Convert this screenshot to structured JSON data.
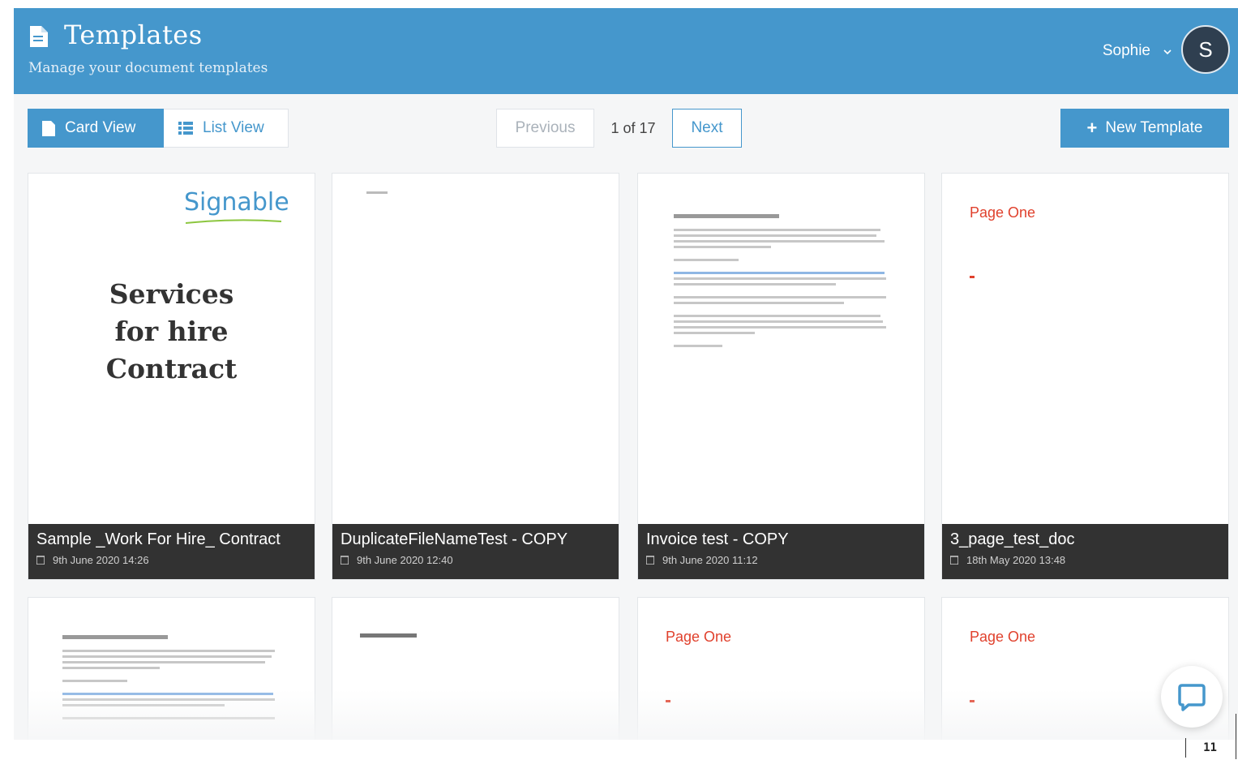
{
  "header": {
    "title": "Templates",
    "subtitle": "Manage your document templates",
    "user_name": "Sophie",
    "avatar_initial": "S",
    "bg_color": "#4597cc"
  },
  "toolbar": {
    "card_view_label": "Card View",
    "list_view_label": "List View",
    "active_view": "Card View",
    "previous_label": "Previous",
    "page_count": "1 of 17",
    "next_label": "Next",
    "new_template_label": "New Template"
  },
  "templates": [
    {
      "name": "Sample _Work For Hire_ Contract",
      "date": "9th June 2020 14:26",
      "preview": "contract"
    },
    {
      "name": "DuplicateFileNameTest - COPY",
      "date": "9th June 2020 12:40",
      "preview": "blank"
    },
    {
      "name": "Invoice test - COPY",
      "date": "9th June 2020 11:12",
      "preview": "letter"
    },
    {
      "name": "3_page_test_doc",
      "date": "18th May 2020 13:48",
      "preview": "page-one"
    }
  ],
  "previews": {
    "signable_logo": "Signable",
    "contract_title": [
      "Services",
      "for hire",
      "Contract"
    ],
    "page_one_heading": "Page One"
  },
  "page_number": "11"
}
